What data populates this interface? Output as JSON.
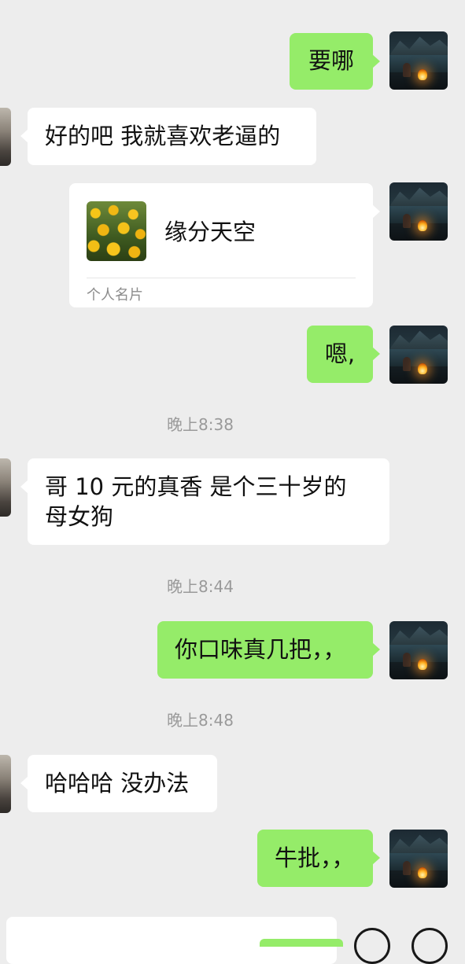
{
  "messages": [
    {
      "side": "me",
      "text": "要哪"
    },
    {
      "side": "other",
      "text": "好的吧 我就喜欢老逼的"
    },
    {
      "side": "me",
      "type": "contact_card",
      "name": "缘分天空",
      "label": "个人名片"
    },
    {
      "side": "me",
      "text": "嗯,"
    },
    {
      "timestamp": "晚上8:38"
    },
    {
      "side": "other",
      "text": "哥 10 元的真香 是个三十岁的",
      "text2": "母女狗"
    },
    {
      "timestamp": "晚上8:44"
    },
    {
      "side": "me",
      "text": "你口味真几把，，"
    },
    {
      "timestamp": "晚上8:48"
    },
    {
      "side": "other",
      "text": "哈哈哈 没办法"
    },
    {
      "side": "me",
      "text": "牛批，，"
    }
  ],
  "icons": {
    "my_avatar": "campfire-lake-photo",
    "other_avatar": "partial-photo-avatar",
    "card_avatar": "sunflower-field-photo",
    "input_buttons": [
      "emoji-icon",
      "plus-icon"
    ]
  },
  "colors": {
    "background": "#ededed",
    "my_bubble": "#95ec69",
    "other_bubble": "#ffffff",
    "timestamp": "#9a9a9a"
  }
}
